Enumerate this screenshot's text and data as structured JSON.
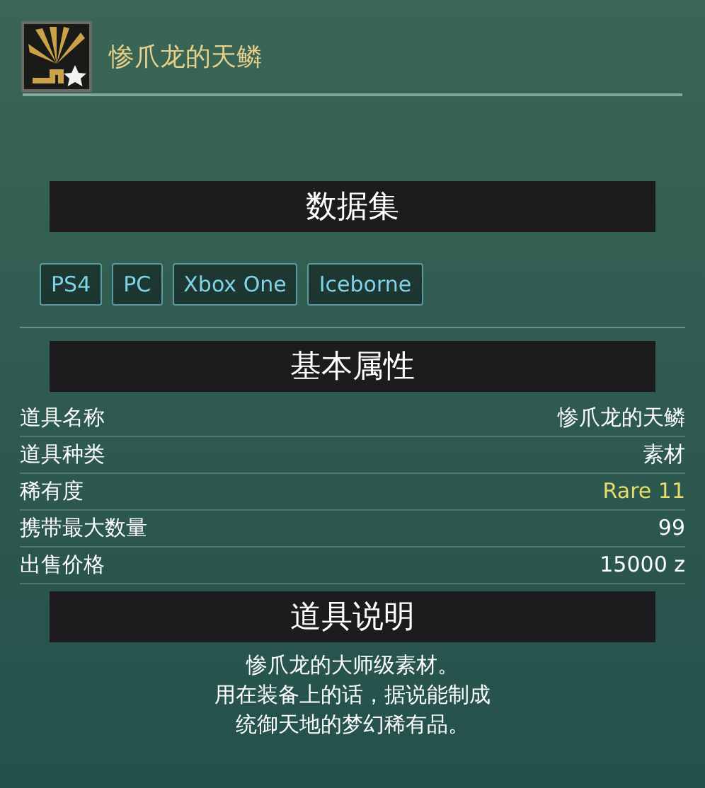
{
  "item": {
    "name": "惨爪龙的天鳞"
  },
  "sections": [
    {
      "title": "数据集"
    },
    {
      "title": "基本属性"
    },
    {
      "title": "道具说明"
    }
  ],
  "datasets": [
    "PS4",
    "PC",
    "Xbox One",
    "Iceborne"
  ],
  "attributes": [
    {
      "label": "道具名称",
      "value": "惨爪龙的天鳞",
      "kind": "plain"
    },
    {
      "label": "道具种类",
      "value": "素材",
      "kind": "plain"
    },
    {
      "label": "稀有度",
      "value": "Rare 11",
      "kind": "rarity"
    },
    {
      "label": "携带最大数量",
      "value": "99",
      "kind": "plain"
    },
    {
      "label": "出售价格",
      "value": "15000 z",
      "kind": "plain"
    }
  ],
  "description": [
    "惨爪龙的大师级素材。",
    "用在装备上的话，据说能制成",
    "统御天地的梦幻稀有品。"
  ]
}
